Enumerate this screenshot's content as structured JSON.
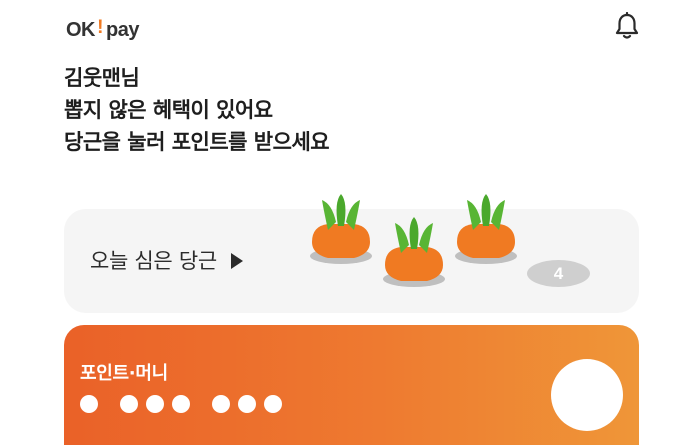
{
  "header": {
    "logo_ok": "OK",
    "logo_excl": "!",
    "logo_pay": "pay",
    "notification_icon": "bell-icon"
  },
  "greeting": {
    "line1": "김웃맨님",
    "line2": "뽑지 않은 혜택이 있어요",
    "line3": "당근을 눌러 포인트를 받으세요"
  },
  "today_card": {
    "label": "오늘 심은 당근",
    "arrow_icon": "triangle-right-icon",
    "remaining_count": "4",
    "carrot_icon": "carrot-icon"
  },
  "points_card": {
    "label": "포인트·머니"
  },
  "colors": {
    "accent_orange": "#ee6e2b",
    "carrot_body": "#f07a22",
    "carrot_leaf": "#5bb83a",
    "card_bg": "#f5f5f5"
  }
}
